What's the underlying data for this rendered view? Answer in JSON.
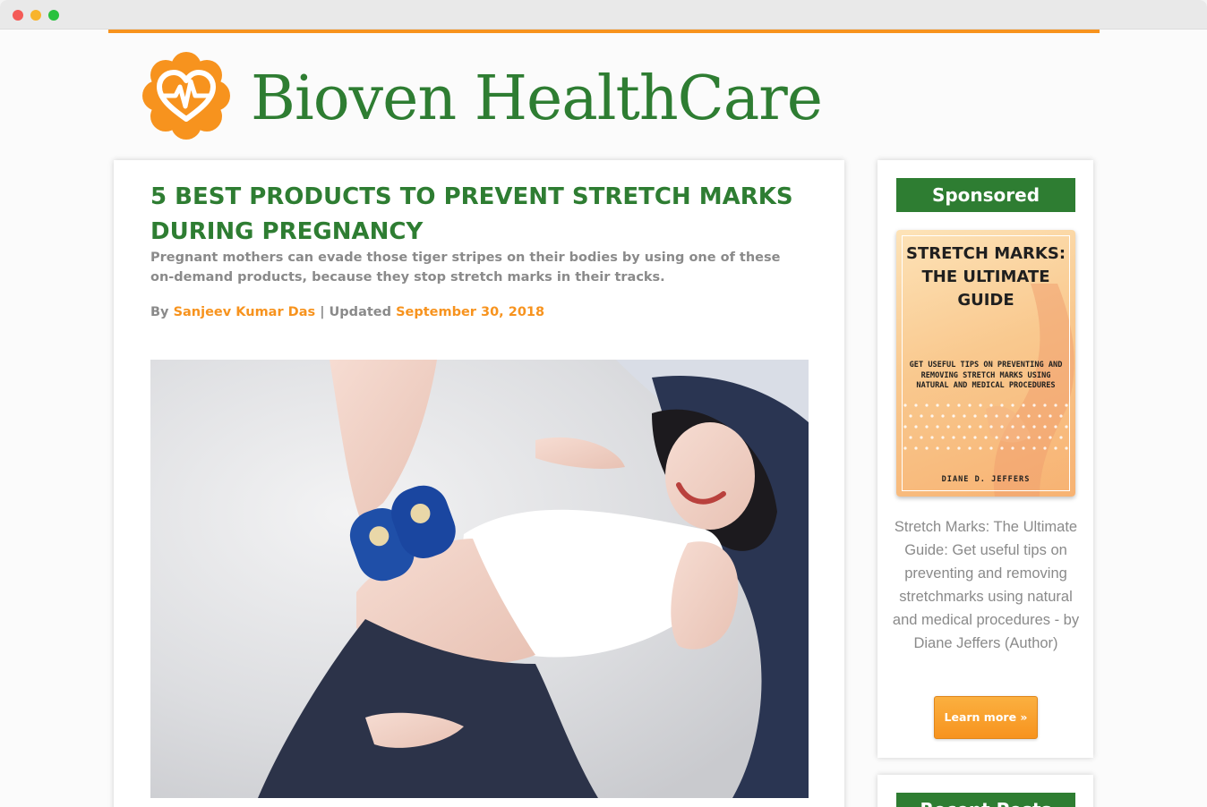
{
  "site": {
    "title": "Bioven HealthCare",
    "brand_color": "#2e7d32",
    "accent_color": "#f7931e",
    "logo_icon": "heart-pulse-icon"
  },
  "article": {
    "title": "5 BEST PRODUCTS TO PREVENT STRETCH MARKS DURING PREGNANCY",
    "subtitle": "Pregnant mothers can evade those tiger stripes on their bodies by using one of these on-demand products, because they stop stretch marks in their tracks.",
    "byline": {
      "by_label": "By",
      "author": "Sanjeev Kumar Das",
      "updated_label": "| Updated",
      "date": "September 30, 2018"
    },
    "hero_image": "pregnant-woman-photo"
  },
  "sidebar": {
    "sponsored": {
      "header": "Sponsored",
      "book": {
        "title": "STRETCH MARKS: THE ULTIMATE GUIDE",
        "tagline": "GET USEFUL TIPS ON PREVENTING AND REMOVING STRETCH MARKS USING NATURAL AND MEDICAL PROCEDURES",
        "author": "DIANE D. JEFFERS"
      },
      "description": "Stretch Marks: The Ultimate Guide: Get useful tips on preventing and removing stretchmarks using natural and medical procedures - by Diane Jeffers (Author)",
      "button_label": "Learn more »"
    },
    "recent_posts": {
      "header": "Recent Posts"
    }
  }
}
